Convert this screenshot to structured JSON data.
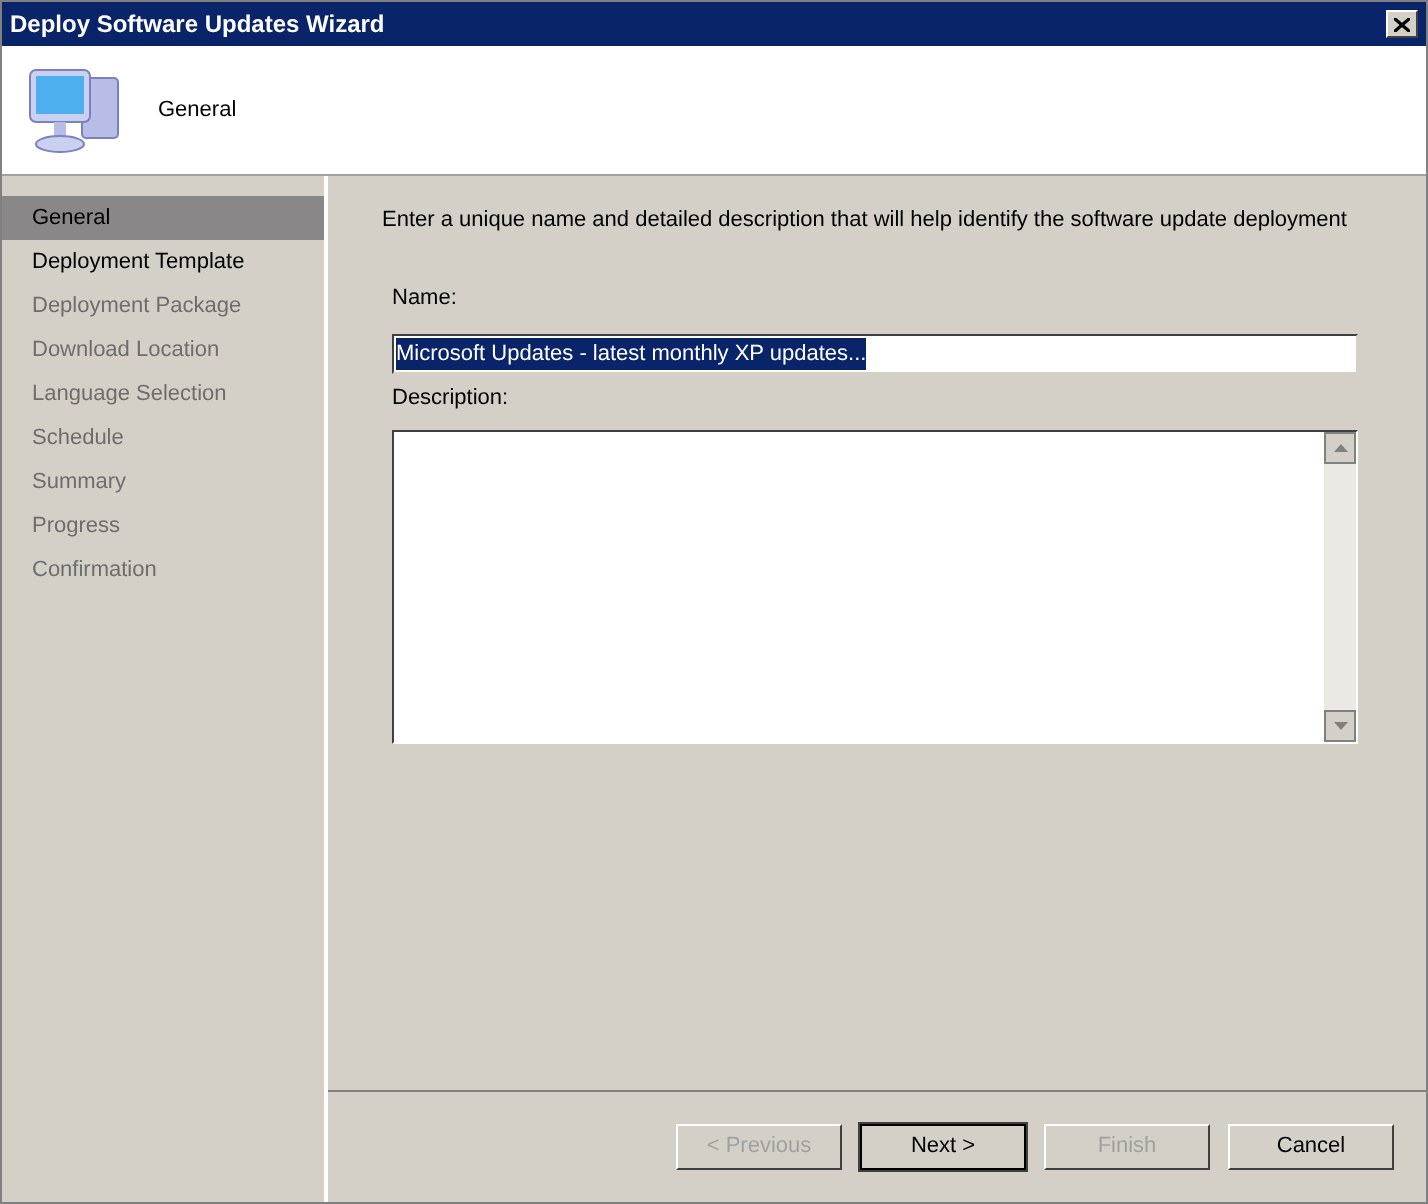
{
  "window": {
    "title": "Deploy Software Updates Wizard"
  },
  "header": {
    "title": "General"
  },
  "sidebar": {
    "items": [
      {
        "label": "General",
        "selected": true,
        "disabled": false
      },
      {
        "label": "Deployment Template",
        "selected": false,
        "disabled": false
      },
      {
        "label": "Deployment Package",
        "selected": false,
        "disabled": true
      },
      {
        "label": "Download Location",
        "selected": false,
        "disabled": true
      },
      {
        "label": "Language Selection",
        "selected": false,
        "disabled": true
      },
      {
        "label": "Schedule",
        "selected": false,
        "disabled": true
      },
      {
        "label": "Summary",
        "selected": false,
        "disabled": true
      },
      {
        "label": "Progress",
        "selected": false,
        "disabled": true
      },
      {
        "label": "Confirmation",
        "selected": false,
        "disabled": true
      }
    ]
  },
  "content": {
    "instruction": "Enter a unique name and detailed description that will help identify the software update deployment",
    "name_label": "Name:",
    "name_value": "Microsoft Updates - latest monthly XP updates...",
    "name_value_highlighted": true,
    "description_label": "Description:"
  },
  "buttons": [
    {
      "label": "< Previous",
      "disabled": true,
      "default": false
    },
    {
      "label": "Next >",
      "disabled": false,
      "default": true
    },
    {
      "label": "Finish",
      "disabled": true,
      "default": false
    },
    {
      "label": "Cancel",
      "disabled": false,
      "default": false
    }
  ]
}
